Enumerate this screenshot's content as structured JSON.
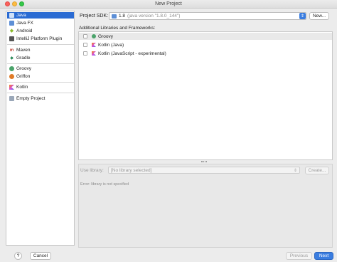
{
  "window": {
    "title": "New Project"
  },
  "sidebar": {
    "items": [
      {
        "label": "Java",
        "icon": "folder-icon",
        "selected": true
      },
      {
        "label": "Java FX",
        "icon": "folder-icon"
      },
      {
        "label": "Android",
        "icon": "android-icon"
      },
      {
        "label": "IntelliJ Platform Plugin",
        "icon": "plugin-icon"
      },
      {
        "label": "Maven",
        "icon": "maven-icon"
      },
      {
        "label": "Gradle",
        "icon": "gradle-icon"
      },
      {
        "label": "Groovy",
        "icon": "groovy-icon"
      },
      {
        "label": "Griffon",
        "icon": "griffon-icon"
      },
      {
        "label": "Kotlin",
        "icon": "kotlin-icon"
      },
      {
        "label": "Empty Project",
        "icon": "empty-project-icon"
      }
    ]
  },
  "sdk": {
    "label": "Project SDK:",
    "value": "1.8",
    "detail": "(java version \"1.8.0_144\")",
    "new_label": "New..."
  },
  "libraries": {
    "label": "Additional Libraries and Frameworks:",
    "items": [
      {
        "label": "Groovy",
        "icon": "groovy-icon",
        "checked": false
      },
      {
        "label": "Kotlin (Java)",
        "icon": "kotlin-icon",
        "checked": false
      },
      {
        "label": "Kotlin (JavaScript - experimental)",
        "icon": "kotlin-icon",
        "checked": false
      }
    ]
  },
  "details": {
    "use_library_label": "Use library:",
    "library_value": "[No library selected]",
    "create_label": "Create...",
    "error": "Error: library is not specified"
  },
  "footer": {
    "help_label": "?",
    "cancel_label": "Cancel",
    "previous_label": "Previous",
    "next_label": "Next"
  },
  "colors": {
    "accent": "#2a6bd3",
    "primary_button": "#3a7de0"
  }
}
